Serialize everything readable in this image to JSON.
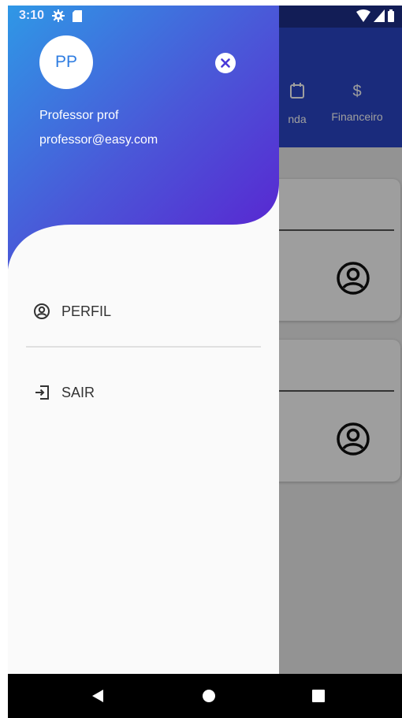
{
  "status_bar": {
    "time": "3:10"
  },
  "background": {
    "tabs": [
      {
        "label": "nda",
        "icon": "calendar-icon"
      },
      {
        "label": "Financeiro",
        "icon": "dollar-icon",
        "symbol": "$"
      }
    ]
  },
  "drawer": {
    "avatar_initials": "PP",
    "user_name": "Professor prof",
    "user_email": "professor@easy.com",
    "menu": {
      "profile_label": "PERFIL",
      "logout_label": "SAIR"
    }
  },
  "colors": {
    "gradient_start": "#2f98e6",
    "gradient_mid": "#4a58d8",
    "gradient_end": "#5b1ed0",
    "avatar_text": "#2f7de1",
    "header_bg": "#2b46c8"
  }
}
